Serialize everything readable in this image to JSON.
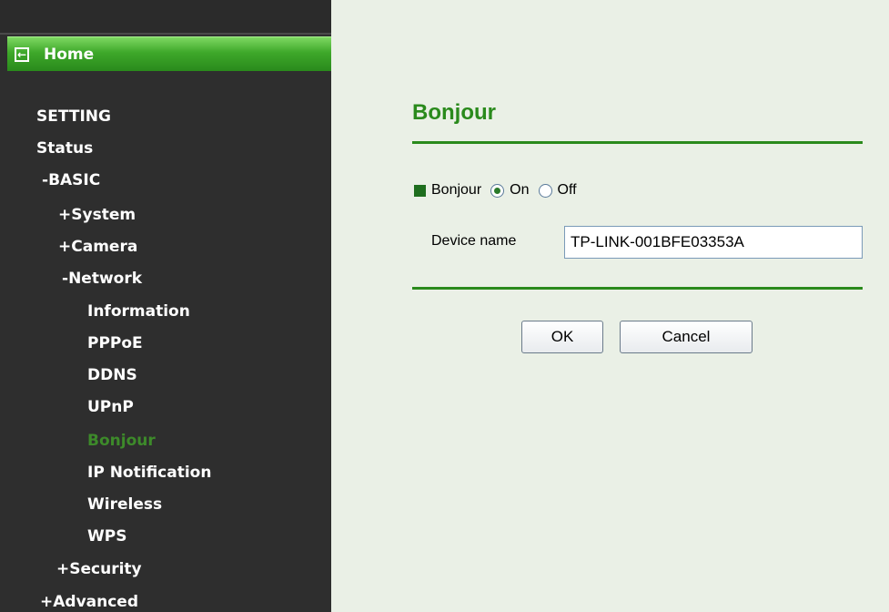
{
  "sidebar": {
    "home_label": "Home",
    "items": [
      {
        "label": "SETTING",
        "prefix": ""
      },
      {
        "label": "Status",
        "prefix": ""
      },
      {
        "label": "BASIC",
        "prefix": "-"
      },
      {
        "label": "System",
        "prefix": "+"
      },
      {
        "label": "Camera",
        "prefix": "+"
      },
      {
        "label": "Network",
        "prefix": "-"
      },
      {
        "label": "Information",
        "prefix": ""
      },
      {
        "label": "PPPoE",
        "prefix": ""
      },
      {
        "label": "DDNS",
        "prefix": ""
      },
      {
        "label": "UPnP",
        "prefix": ""
      },
      {
        "label": "Bonjour",
        "prefix": "",
        "active": true
      },
      {
        "label": "IP Notification",
        "prefix": ""
      },
      {
        "label": "Wireless",
        "prefix": ""
      },
      {
        "label": "WPS",
        "prefix": ""
      },
      {
        "label": "Security",
        "prefix": "+"
      },
      {
        "label": "Advanced",
        "prefix": "+"
      }
    ]
  },
  "main": {
    "title": "Bonjour",
    "bonjour_label": "Bonjour",
    "on_label": "On",
    "off_label": "Off",
    "bonjour_state": "On",
    "device_name_label": "Device name",
    "device_name_value": "TP-LINK-001BFE03353A",
    "ok_label": "OK",
    "cancel_label": "Cancel"
  },
  "colors": {
    "accent_green": "#2a8a1c",
    "sidebar_bg": "#2e2e2e",
    "content_bg": "#eaf0e6"
  }
}
